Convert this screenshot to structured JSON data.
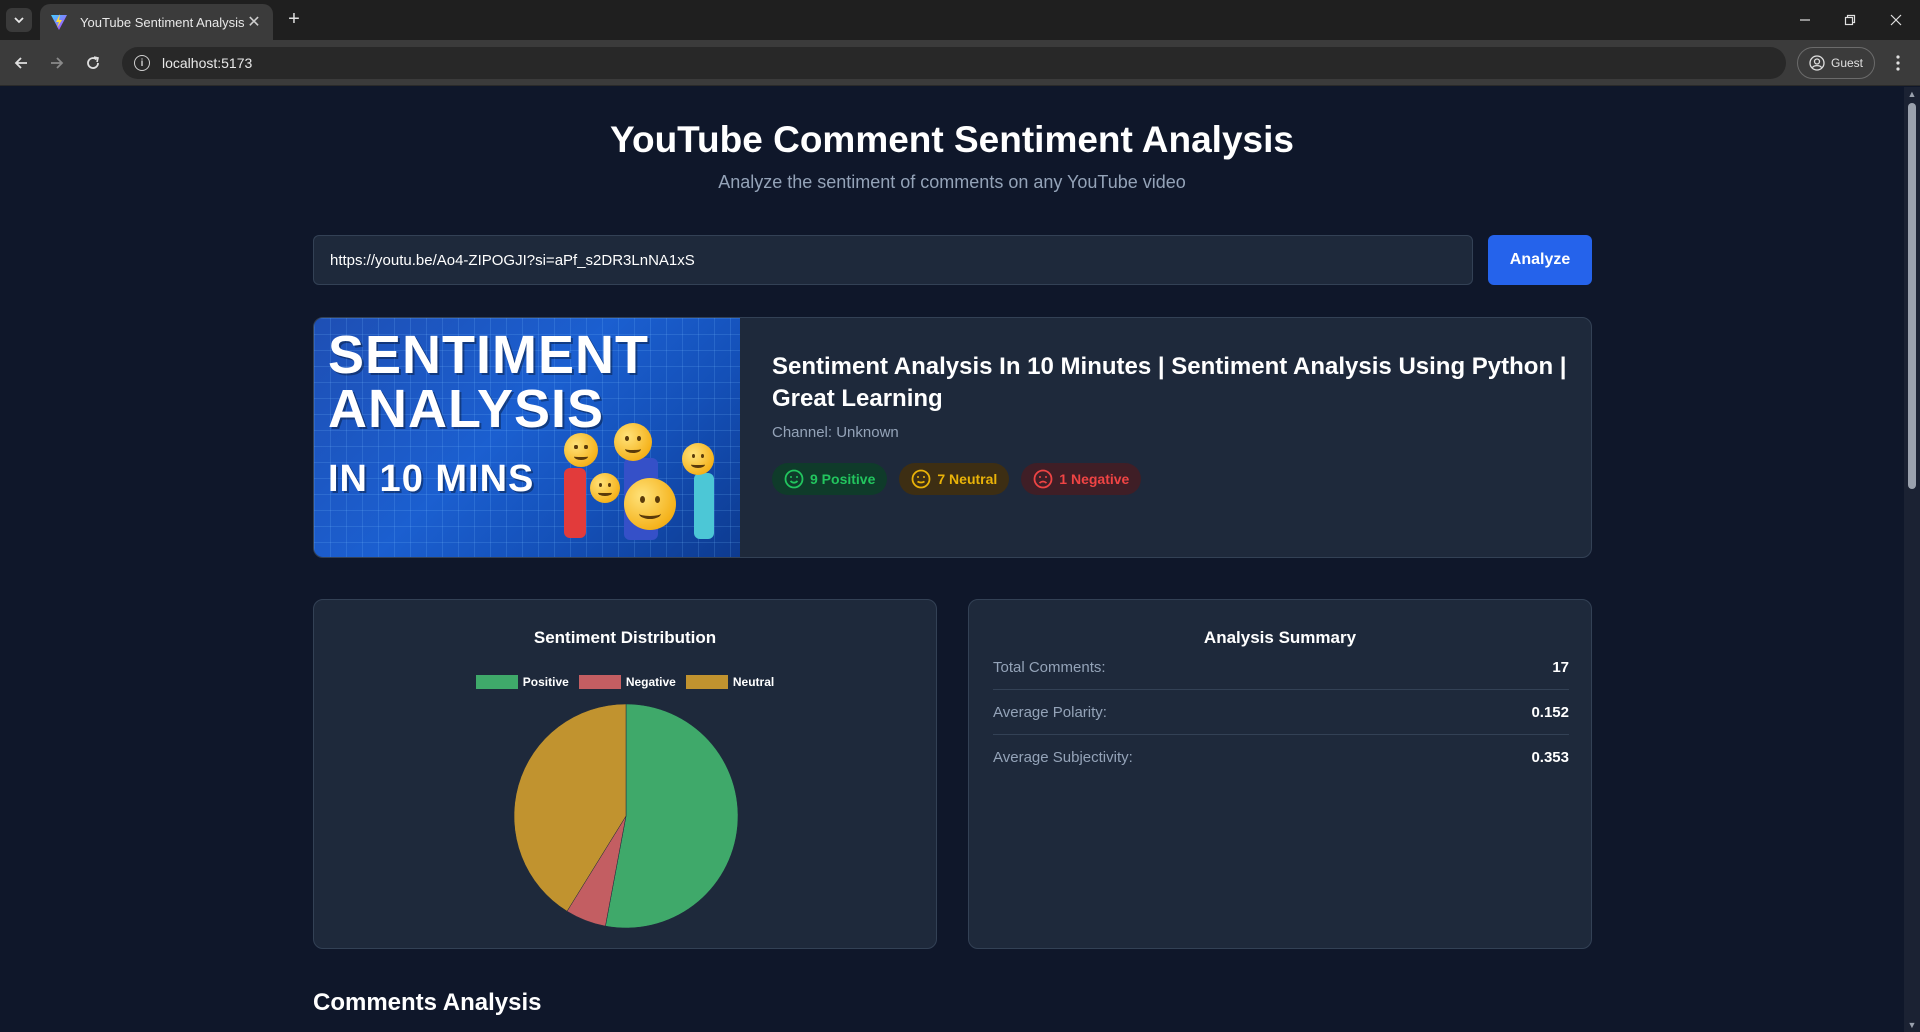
{
  "browser": {
    "tab_title": "YouTube Sentiment Analysis",
    "url": "localhost:5173",
    "profile_label": "Guest"
  },
  "header": {
    "title": "YouTube Comment Sentiment Analysis",
    "subtitle": "Analyze the sentiment of comments on any YouTube video"
  },
  "search": {
    "value": "https://youtu.be/Ao4-ZIPOGJI?si=aPf_s2DR3LnNA1xS",
    "button_label": "Analyze"
  },
  "video": {
    "thumbnail_lines": [
      "SENTIMENT",
      "ANALYSIS",
      "IN 10 MINS"
    ],
    "title": "Sentiment Analysis In 10 Minutes | Sentiment Analysis Using Python | Great Learning",
    "channel": "Channel: Unknown",
    "badges": {
      "positive": "9 Positive",
      "neutral": "7 Neutral",
      "negative": "1 Negative"
    }
  },
  "colors": {
    "positive": "#3fa96a",
    "negative": "#c35e62",
    "neutral": "#c1932f",
    "accent": "#2563eb"
  },
  "distribution": {
    "title": "Sentiment Distribution"
  },
  "chart_data": {
    "type": "pie",
    "title": "Sentiment Distribution",
    "labels": [
      "Positive",
      "Negative",
      "Neutral"
    ],
    "values": [
      9,
      1,
      7
    ],
    "colors": [
      "#3fa96a",
      "#c35e62",
      "#c1932f"
    ],
    "legend_position": "top"
  },
  "summary": {
    "title": "Analysis Summary",
    "rows": [
      {
        "label": "Total Comments:",
        "value": "17"
      },
      {
        "label": "Average Polarity:",
        "value": "0.152"
      },
      {
        "label": "Average Subjectivity:",
        "value": "0.353"
      }
    ]
  },
  "comments": {
    "title": "Comments Analysis"
  }
}
